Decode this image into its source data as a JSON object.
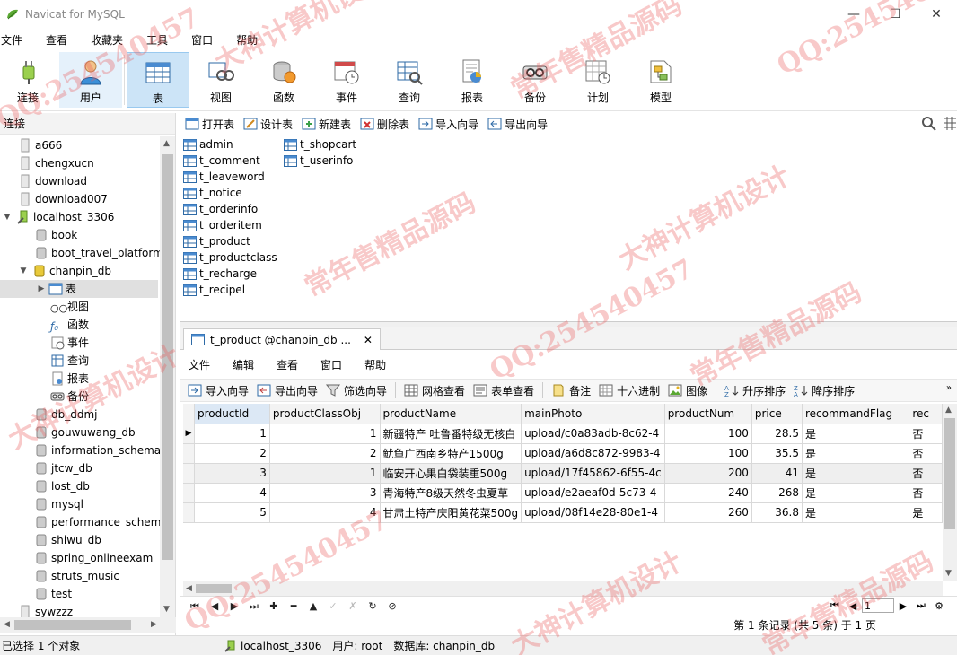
{
  "window": {
    "title": "Navicat for MySQL",
    "minimize": "—",
    "maximize": "☐",
    "close": "✕"
  },
  "menubar": [
    "文件",
    "查看",
    "收藏夹",
    "工具",
    "窗口",
    "帮助"
  ],
  "toolbar": {
    "connect": "连接",
    "user": "用户",
    "table": "表",
    "view": "视图",
    "function": "函数",
    "event": "事件",
    "query": "查询",
    "report": "报表",
    "backup": "备份",
    "schedule": "计划",
    "model": "模型"
  },
  "leftpane": {
    "header": "连接",
    "nodes": [
      "a666",
      "chengxucn",
      "download",
      "download007",
      "localhost_3306",
      "book",
      "boot_travel_platform",
      "chanpin_db",
      "表",
      "视图",
      "函数",
      "事件",
      "查询",
      "报表",
      "备份",
      "db_ddmj",
      "gouwuwang_db",
      "information_schema",
      "jtcw_db",
      "lost_db",
      "mysql",
      "performance_schema",
      "shiwu_db",
      "spring_onlineexam",
      "struts_music",
      "test",
      "sywzzz"
    ]
  },
  "objtoolbar": {
    "open": "打开表",
    "design": "设计表",
    "new": "新建表",
    "delete": "删除表",
    "import": "导入向导",
    "export": "导出向导"
  },
  "objects": [
    "admin",
    "t_comment",
    "t_leaveword",
    "t_notice",
    "t_orderinfo",
    "t_orderitem",
    "t_product",
    "t_productclass",
    "t_recharge",
    "t_recipel",
    "t_shopcart",
    "t_userinfo"
  ],
  "tab": {
    "label": "t_product @chanpin_db ...",
    "close": "✕"
  },
  "tabmenu": [
    "文件",
    "编辑",
    "查看",
    "窗口",
    "帮助"
  ],
  "gridtoolbar": {
    "import": "导入向导",
    "export": "导出向导",
    "filter": "筛选向导",
    "gridview": "网格查看",
    "formview": "表单查看",
    "memo": "备注",
    "hex": "十六进制",
    "image": "图像",
    "asc": "升序排序",
    "desc": "降序排序"
  },
  "grid": {
    "columns": [
      "productId",
      "productClassObj",
      "productName",
      "mainPhoto",
      "productNum",
      "price",
      "recommandFlag",
      "rec"
    ],
    "rows": [
      [
        "1",
        "1",
        "新疆特产 吐鲁番特级无核白",
        "upload/c0a83adb-8c62-4",
        "100",
        "28.5",
        "是",
        "否"
      ],
      [
        "2",
        "2",
        "鱿鱼广西南乡特产1500g",
        "upload/a6d8c872-9983-4",
        "100",
        "35.5",
        "是",
        "否"
      ],
      [
        "3",
        "1",
        "临安开心果白袋装重500g",
        "upload/17f45862-6f55-4c",
        "200",
        "41",
        "是",
        "否"
      ],
      [
        "4",
        "3",
        "青海特产8级天然冬虫夏草",
        "upload/e2aeaf0d-5c73-4",
        "240",
        "268",
        "是",
        "否"
      ],
      [
        "5",
        "4",
        "甘肃土特产庆阳黄花菜500g",
        "upload/08f14e28-80e1-4",
        "260",
        "36.8",
        "是",
        "是"
      ]
    ]
  },
  "pager": {
    "page": "1"
  },
  "recinfo": "第 1 条记录 (共 5 条) 于 1 页",
  "status": {
    "selected": "已选择 1 个对象",
    "connection": "localhost_3306",
    "user": "用户: root",
    "database": "数据库: chanpin_db"
  },
  "watermark": [
    "QQ:254540457",
    "大神计算机设计",
    "常年售精品源码",
    "QQ:254540457",
    "大神计算机设计",
    "常年售精品源码",
    "QQ:254540457",
    "大神计算机设计",
    "常年售精品源码",
    "QQ:254540457",
    "大神计算机设计",
    "常年售精品源码"
  ],
  "colors": {
    "accent": "#cce4f7",
    "selection": "#e0e0e0",
    "watermark": "#eb5a5a"
  }
}
